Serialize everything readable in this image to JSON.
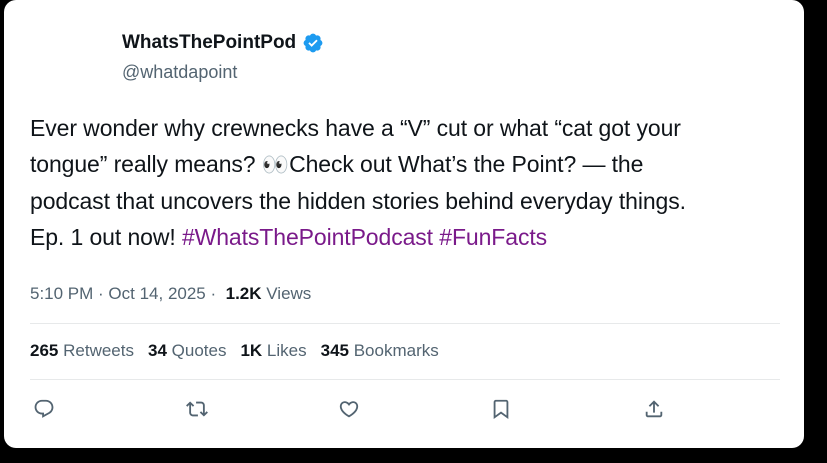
{
  "user": {
    "display_name": "WhatsThePointPod",
    "handle": "@whatdapoint",
    "verified_color": "#1d9bf0"
  },
  "tweet": {
    "lines": [
      "Ever wonder why crewnecks have a “V” cut or what “cat got your",
      "tongue” really means? ",
      "Check out What’s the Point? — the",
      "podcast that uncovers the hidden stories behind everyday things.",
      "Ep. 1 out now! "
    ],
    "emoji": "👀",
    "hashtags": [
      "#WhatsThePointPodcast",
      "#FunFacts"
    ],
    "hashtag_color": "#7a1a8a"
  },
  "meta": {
    "time": "5:10 PM",
    "separator": " · ",
    "date": "Oct 14, 2025",
    "separator2": " · ",
    "views_count": "1.2K",
    "views_label": "Views"
  },
  "stats": {
    "retweets": {
      "count": "265",
      "label": "Retweets"
    },
    "quotes": {
      "count": "34",
      "label": "Quotes"
    },
    "likes": {
      "count": "1K",
      "label": "Likes"
    },
    "bookmarks": {
      "count": "345",
      "label": "Bookmarks"
    }
  },
  "actions": {
    "reply": "reply-icon",
    "retweet": "retweet-icon",
    "like": "heart-icon",
    "bookmark": "bookmark-icon",
    "share": "share-icon"
  }
}
